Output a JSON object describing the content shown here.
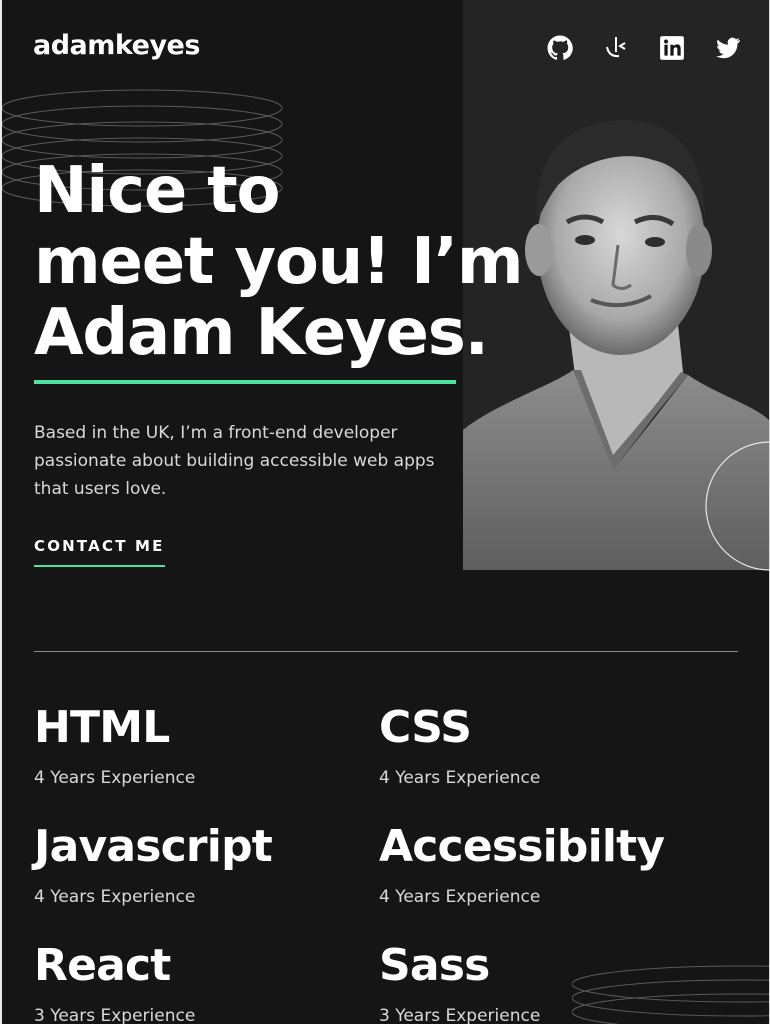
{
  "header": {
    "logo": "adamkeyes",
    "social_links": [
      {
        "name": "github",
        "icon": "github-icon"
      },
      {
        "name": "frontend-mentor",
        "icon": "frontend-mentor-icon"
      },
      {
        "name": "linkedin",
        "icon": "linkedin-icon"
      },
      {
        "name": "twitter",
        "icon": "twitter-icon"
      }
    ]
  },
  "hero": {
    "title_lines": [
      "Nice to",
      "meet you! I’m",
      "Adam Keyes."
    ],
    "description": "Based in the UK, I’m a front-end developer passionate about building accessible web apps that users love.",
    "cta_label": "CONTACT ME",
    "accent_color": "#4ee1a0"
  },
  "skills": [
    {
      "name": "HTML",
      "experience": "4 Years Experience"
    },
    {
      "name": "CSS",
      "experience": "4 Years Experience"
    },
    {
      "name": "Javascript",
      "experience": "4 Years Experience"
    },
    {
      "name": "Accessibilty",
      "experience": "4 Years Experience"
    },
    {
      "name": "React",
      "experience": "3 Years Experience"
    },
    {
      "name": "Sass",
      "experience": "3 Years Experience"
    }
  ],
  "colors": {
    "background": "#151515",
    "panel": "#242424",
    "accent": "#4ee1a0",
    "text_muted": "#d9d9d9"
  }
}
